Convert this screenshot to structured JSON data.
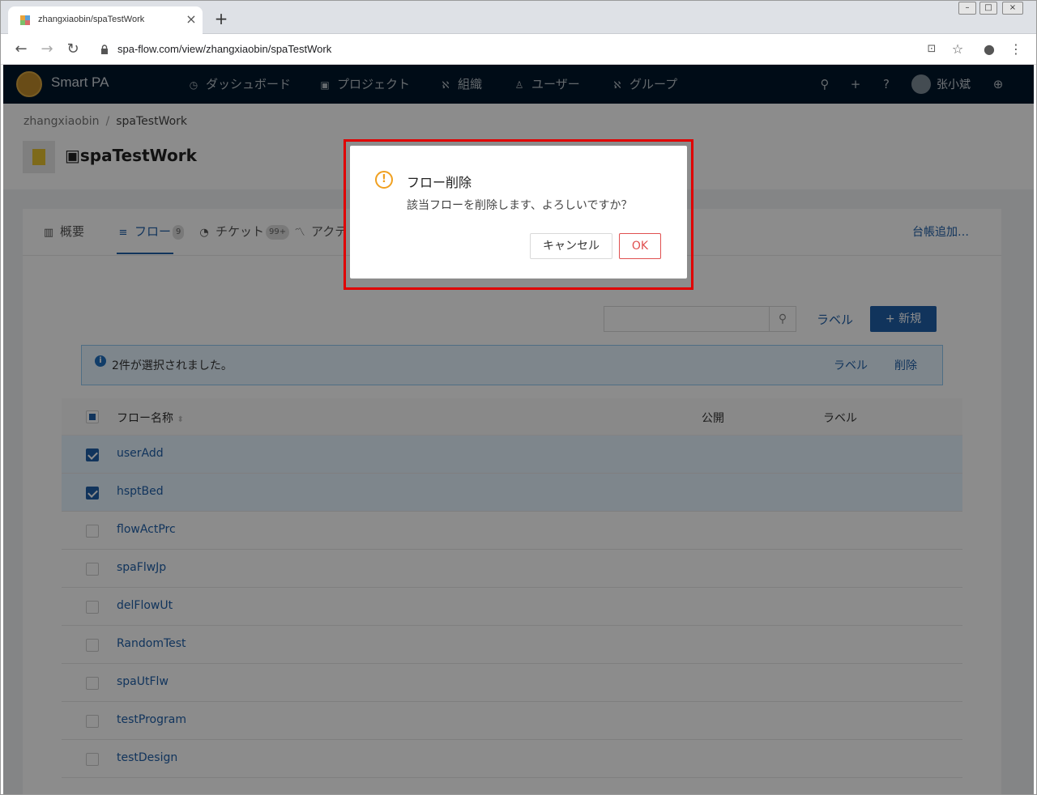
{
  "browser": {
    "tab_title": "zhangxiaobin/spaTestWork",
    "url": "spa-flow.com/view/zhangxiaobin/spaTestWork"
  },
  "header": {
    "brand": "Smart PA",
    "nav": [
      {
        "label": "ダッシュボード",
        "icon": "dashboard-icon"
      },
      {
        "label": "プロジェクト",
        "icon": "project-icon"
      },
      {
        "label": "組織",
        "icon": "organization-icon"
      },
      {
        "label": "ユーザー",
        "icon": "user-icon"
      },
      {
        "label": "グループ",
        "icon": "group-icon"
      }
    ],
    "username": "张小斌"
  },
  "breadcrumb": {
    "owner": "zhangxiaobin",
    "separator": "/",
    "project": "spaTestWork"
  },
  "project": {
    "title": "spaTestWork"
  },
  "tabs": [
    {
      "label": "概要",
      "icon": "chart-icon"
    },
    {
      "label": "フロー",
      "count": "9",
      "icon": "flow-icon"
    },
    {
      "label": "チケット",
      "count": "99+",
      "icon": "ticket-icon"
    },
    {
      "label": "アクテ",
      "icon": "activity-icon"
    }
  ],
  "ledger_link": "台帳追加…",
  "toolbar": {
    "search_placeholder": "",
    "label_button": "ラベル",
    "new_button": "+ 新規"
  },
  "selection_alert": {
    "message": "2件が選択されました。",
    "label_action": "ラベル",
    "delete_action": "削除"
  },
  "table": {
    "columns": [
      "フロー名称",
      "公開",
      "ラベル"
    ],
    "rows": [
      {
        "name": "userAdd",
        "selected": true
      },
      {
        "name": "hsptBed",
        "selected": true
      },
      {
        "name": "flowActPrc",
        "selected": false
      },
      {
        "name": "spaFlwJp",
        "selected": false
      },
      {
        "name": "delFlowUt",
        "selected": false
      },
      {
        "name": "RandomTest",
        "selected": false
      },
      {
        "name": "spaUtFlw",
        "selected": false
      },
      {
        "name": "testProgram",
        "selected": false
      },
      {
        "name": "testDesign",
        "selected": false
      }
    ]
  },
  "dialog": {
    "icon": "warning-icon",
    "title": "フロー削除",
    "message": "該当フローを削除します、よろしいですか？",
    "cancel": "キャンセル",
    "ok": "OK"
  },
  "colors": {
    "header_bg": "#00172a",
    "accent": "#1f5fa8",
    "ok_button": "#e05050",
    "warning": "#f0a020",
    "highlight_frame": "#e00000"
  }
}
